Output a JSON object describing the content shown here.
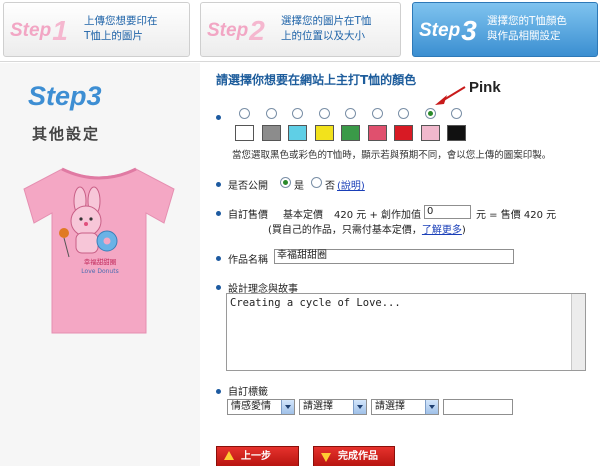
{
  "steps": [
    {
      "num_text": "Step",
      "num_digit": "1",
      "line1": "上傳您想要印在",
      "line2": "T恤上的圖片"
    },
    {
      "num_text": "Step",
      "num_digit": "2",
      "line1": "選擇您的圖片在T恤",
      "line2": "上的位置以及大小"
    },
    {
      "num_text": "Step",
      "num_digit": "3",
      "line1": "選擇您的T恤顏色",
      "line2": "與作品相關設定"
    }
  ],
  "left": {
    "big_step": "Step3",
    "subtitle": "其他設定",
    "shirt_text_1": "幸福甜甜圈",
    "shirt_text_2": "Love Donuts"
  },
  "color_section": {
    "heading": "請選擇你想要在網站上主打T恤的顏色",
    "selected_label": "Pink",
    "note": "當您選取黑色或彩色的T恤時，顯示若與預期不同，會以您上傳的圖案印製。",
    "colors": [
      "#ffffff",
      "#8c8c8c",
      "#5fcfe6",
      "#f2e21c",
      "#3a9a48",
      "#e0506e",
      "#d81a24",
      "#f0b8cc",
      "#111111"
    ],
    "selected_index": 7
  },
  "public_section": {
    "label": "是否公開",
    "yes": "是",
    "no": "否",
    "help": "(說明)"
  },
  "price_section": {
    "label": "自訂售價",
    "base": "基本定價",
    "base_value": "420 元 + 創作加值",
    "input_value": "0",
    "suffix": "元 = 售價 420 元",
    "note": "(買自己的作品，只需付基本定價，",
    "learn_more": "了解更多",
    "note_end": ")"
  },
  "name_section": {
    "label": "作品名稱",
    "value": "幸福甜甜圈"
  },
  "story_section": {
    "label": "設計理念與故事",
    "value": "Creating a cycle of Love..."
  },
  "tag_section": {
    "label": "自訂標籤",
    "select1": "情感愛情",
    "select2": "請選擇",
    "select3": "請選擇"
  },
  "buttons": {
    "prev": "上一步",
    "finish": "完成作品"
  },
  "colors": {
    "accent_blue": "#3d8ed3",
    "button_red": "#d8221d",
    "shirt_pink": "#f4a7c4"
  }
}
